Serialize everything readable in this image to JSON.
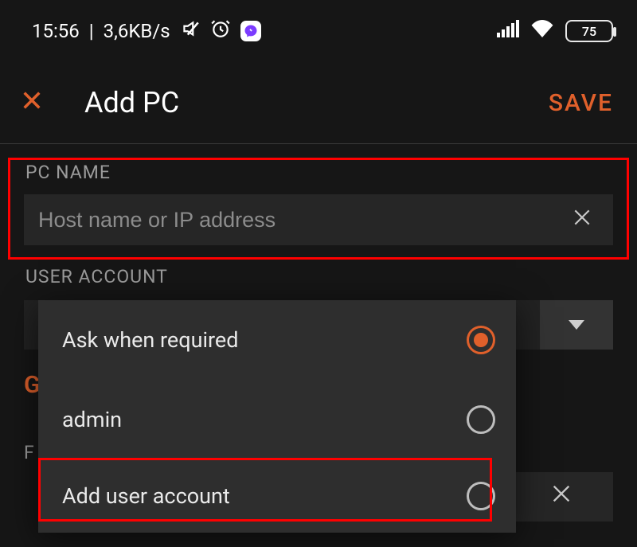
{
  "status": {
    "time": "15:56",
    "speed": "3,6KB/s",
    "battery_pct": "75"
  },
  "header": {
    "title": "Add PC",
    "save_label": "SAVE"
  },
  "pcname": {
    "label": "PC NAME",
    "placeholder": "Host name or IP address",
    "value": ""
  },
  "user_account": {
    "label": "USER ACCOUNT",
    "options": [
      {
        "label": "Ask when required",
        "selected": true
      },
      {
        "label": "admin",
        "selected": false
      },
      {
        "label": "Add user account",
        "selected": false
      }
    ]
  },
  "obscured": {
    "g": "G",
    "f": "F"
  },
  "colors": {
    "accent": "#E0602B",
    "highlight": "#ff0000"
  }
}
